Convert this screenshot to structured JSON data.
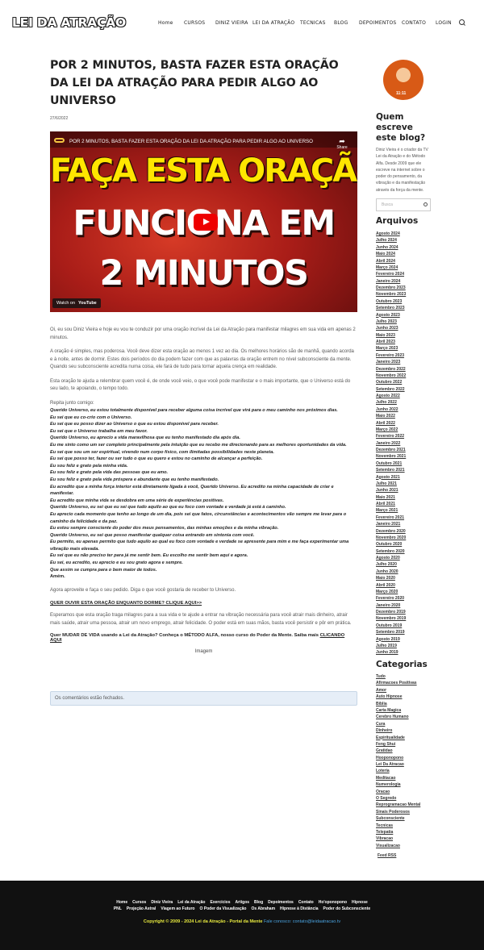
{
  "header": {
    "logo": "LEI DA ATRAÇÃO",
    "nav": [
      "Home",
      "CURSOS",
      "DINIZ VIEIRA",
      "LEI DA ATRAÇÃO",
      "TECNICAS",
      "BLOG",
      "DEPOIMENTOS",
      "CONTATO",
      "LOGIN"
    ]
  },
  "post": {
    "title": "POR 2 MINUTOS, BASTA FAZER ESTA ORAÇÃO DA LEI DA ATRAÇÃO PARA PEDIR ALGO AO UNIVERSO",
    "date": "27/6/2022",
    "video": {
      "title": "POR 2 MINUTOS, BASTA FAZER ESTA ORAÇÃO DA LEI DA ATRAÇÃO PARA PEDIR ALGO AO UNIVERSO",
      "share": "Share",
      "line1": "FAÇA ESTA ORAÇÃO",
      "line2": "FUNCIONA EM",
      "line3": "2 MINUTOS",
      "watch_on": "Watch on",
      "youtube": "YouTube"
    },
    "intro": "Oi, eu sou Diniz Vieira e hoje eu vou te conduzir por uma oração incrível da Lei da Atração para manifestar milagres em sua vida em apenas 2 minutos.",
    "para2": "A oração é simples, mas poderosa. Você deve dizer esta oração ao menos 1 vez ao dia. Os melhores horários são de manhã, quando acorda e à noite, antes de dormir. Estes dois períodos do dia podem fazer com que as palavras da oração entrem no nível subconsciente da mente. Quando seu subconsciente acredita numa coisa, ele fará de tudo para tornar aquela crença em realidade.",
    "para3": "Esta oração te ajuda a relembrar quem você é, de onde você veio, o que você pode manifestar e o mais importante, que o Universo está do seu lado, te apoiando, o tempo todo.",
    "repita": "Repita junto comigo:",
    "prayer": [
      "Querido Universo, eu estou totalmente disponível para receber alguma coisa incrível que virá para o meu caminho nos próximos dias.",
      "Eu sei que eu co-crio com o Universo.",
      "Eu sei que eu posso dizer ao Universo o que eu estou disponível para receber.",
      "Eu sei que o Universo trabalha em meu favor.",
      "Querido Universo, eu aprecio a vida maravilhosa que eu tenho manifestado dia após dia.",
      "Eu me sinto como um ser completo principalmente pela intuição que eu recebo me direcionando para as melhores oportunidades da vida.",
      "Eu sei que sou um ser espiritual, vivendo num corpo físico, com ilimitadas possibilidades neste planeta.",
      "Eu sei que posso ter, fazer ou ser tudo o que eu quero e estou no caminho de alcançar a perfeição.",
      "Eu sou feliz e grato pela minha vida.",
      "Eu sou feliz e grato pela vida das pessoas que eu amo.",
      "Eu sou feliz e grato pela vida próspera e abundante que eu tenho manifestado.",
      "Eu acredito que a minha força interior está diretamente ligada à você, Querido Universo. Eu acredito na minha capacidade de criar e manifestar.",
      "Eu acredito que minha vida se desdobra em uma série de experiências positivas.",
      "Querido Universo, eu sei que eu sei que tudo aquilo ao que eu foco com vontade e verdade já está à caminho.",
      "Eu aprecio cada momento que tenho ao longo de um dia, pois sei que fatos, circunstâncias e acontecimentos vão sempre me levar para o caminho da felicidade e da paz.",
      "Eu estou sempre consciente do poder dos meus pensamentos, das minhas emoções e da minha vibração.",
      "Querido Universo, eu sei que posso manifestar qualquer coisa entrando em sintonia com você.",
      "Eu permito, eu apenas permito que tudo aquilo ao qual eu foco com vontade e verdade se apresente para mim e me faça experimentar uma vibração mais elevada.",
      "Eu sei que eu não preciso ter para já me sentir bem. Eu escolho me sentir bem aqui e agora.",
      "Eu sei, eu acredito, eu aprecio e eu sou grato agora e sempre.",
      "Que assim se cumpra para o bem maior de todos.",
      "Amém."
    ],
    "agora": "Agora aproveite e faça o seu pedido. Diga o que você gostaria de receber to Universo.",
    "dormir_link": "QUER OUVIR ESTA ORAÇÃO ENQUANTO DORME? CLIQUE AQUI>>",
    "esperamos": "Esperamos que esta oração traga milagres para a sua vida e te ajude a entrar na vibração necessária para você atrair mais dinheiro, atrair mais saúde, atrair uma pessoa, atrair um novo emprego, atrair felicidade. O poder está em suas mãos, basta você persistir e pôr em prática.",
    "mudar_text": "Quer MUDAR DE VIDA usando a Lei da Atração? Conheça o MÉTODO ALFA, nosso curso do Poder da Mente. Saiba mais",
    "mudar_link": "CLICANDO AQUI",
    "image_alt": "Imagem",
    "comments_closed": "Os comentários estão fechados."
  },
  "sidebar": {
    "about_title": "Quem escreve este blog?",
    "about_text": "Diniz Vieira é o criador da TV Lei da Atração e do Método Alfa. Desde 2009 que ele escreve na internet sobre o poder do pensamento, da vibração e da manifestação através da força da mente.",
    "search_placeholder": "Busca",
    "archives_title": "Arquivos",
    "archives": [
      "Agosto 2024",
      "Julho 2024",
      "Junho 2024",
      "Maio 2024",
      "Abril 2024",
      "Março 2024",
      "Fevereiro 2024",
      "Janeiro 2024",
      "Dezembro 2023",
      "Novembro 2023",
      "Outubro 2023",
      "Setembro 2023",
      "Agosto 2023",
      "Julho 2023",
      "Junho 2023",
      "Maio 2023",
      "Abril 2023",
      "Março 2023",
      "Fevereiro 2023",
      "Janeiro 2023",
      "Dezembro 2022",
      "Novembro 2022",
      "Outubro 2022",
      "Setembro 2022",
      "Agosto 2022",
      "Julho 2022",
      "Junho 2022",
      "Maio 2022",
      "Abril 2022",
      "Março 2022",
      "Fevereiro 2022",
      "Janeiro 2022",
      "Dezembro 2021",
      "Novembro 2021",
      "Outubro 2021",
      "Setembro 2021",
      "Agosto 2021",
      "Julho 2021",
      "Junho 2021",
      "Maio 2021",
      "Abril 2021",
      "Março 2021",
      "Fevereiro 2021",
      "Janeiro 2021",
      "Dezembro 2020",
      "Novembro 2020",
      "Outubro 2020",
      "Setembro 2020",
      "Agosto 2020",
      "Julho 2020",
      "Junho 2020",
      "Maio 2020",
      "Abril 2020",
      "Março 2020",
      "Fevereiro 2020",
      "Janeiro 2020",
      "Dezembro 2019",
      "Novembro 2019",
      "Outubro 2019",
      "Setembro 2019",
      "Agosto 2019",
      "Julho 2019",
      "Junho 2019"
    ],
    "categories_title": "Categorias",
    "categories": [
      "Tudo",
      "Afirmacoes Positivas",
      "Amor",
      "Auto Hipnose",
      "Biblia",
      "Carta Magica",
      "Cerebro Humano",
      "Cura",
      "Dinheiro",
      "Espiritualidade",
      "Feng Shui",
      "Gratidao",
      "Hooponopono",
      "Lei Da Atracao",
      "Loteria",
      "Meditacao",
      "Numerologia",
      "Oracao",
      "O Segredo",
      "Reprogramacao Mental",
      "Sinais Poderosos",
      "Subconsciente",
      "Tecnicas",
      "Telepatia",
      "Vibracao",
      "Visualizacao"
    ],
    "feed": "Feed RSS"
  },
  "footer": {
    "nav1": [
      "Home",
      "Cursos",
      "Diniz Vieira",
      "Lei da Atração",
      "Exercícios",
      "Artigos",
      "Blog",
      "Depoimentos",
      "Contato",
      "Ho'oponopono",
      "Hipnose"
    ],
    "nav2": [
      "PNL",
      "Projeção Astral",
      "Viagem ao Futuro",
      "O Poder da Visualização",
      "Os Abraham",
      "Hipnose à Distância",
      "Poder do Subconsciente"
    ],
    "copyright": "Copyright © 2009 - 2024 Lei da Atração - Portal da Mente",
    "contact": "Fale conosco: contato@leidaatracao.tv"
  }
}
